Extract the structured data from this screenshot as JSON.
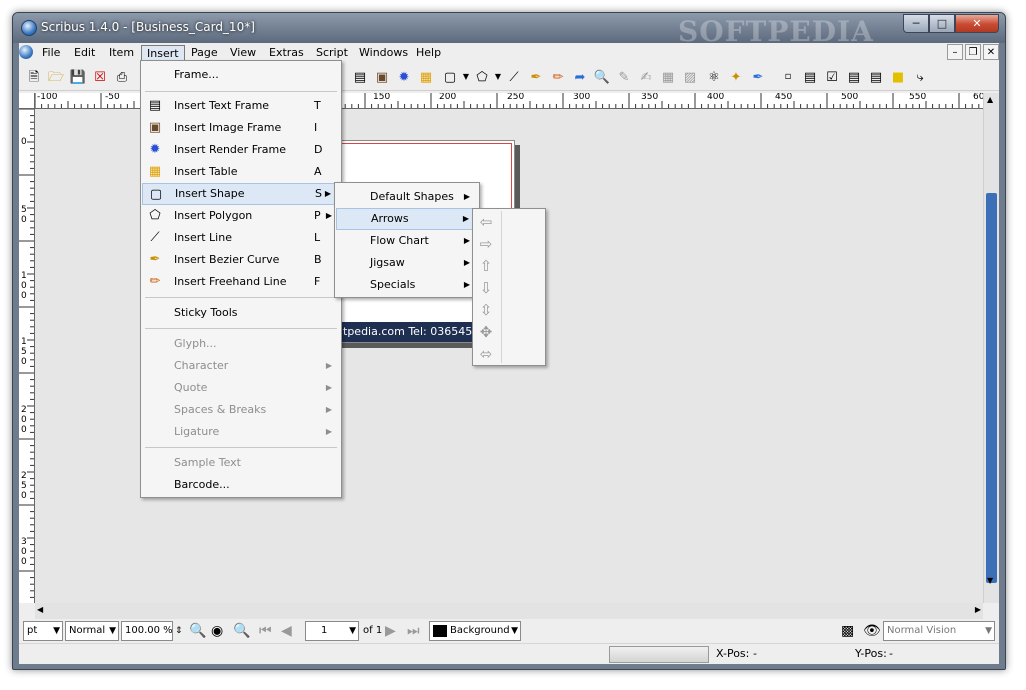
{
  "window": {
    "title": "Scribus 1.4.0 - [Business_Card_10*]",
    "watermark": "SOFTPEDIA"
  },
  "menubar": {
    "items": [
      "File",
      "Edit",
      "Item",
      "Insert",
      "Page",
      "View",
      "Extras",
      "Script",
      "Windows",
      "Help"
    ],
    "active": "Insert"
  },
  "insert_menu": {
    "frame": "Frame...",
    "text_frame": {
      "label": "Insert Text Frame",
      "shortcut": "T"
    },
    "image_frame": {
      "label": "Insert Image Frame",
      "shortcut": "I"
    },
    "render_frame": {
      "label": "Insert Render Frame",
      "shortcut": "D"
    },
    "table": {
      "label": "Insert Table",
      "shortcut": "A"
    },
    "shape": {
      "label": "Insert Shape",
      "shortcut": "S"
    },
    "polygon": {
      "label": "Insert Polygon",
      "shortcut": "P"
    },
    "line": {
      "label": "Insert Line",
      "shortcut": "L"
    },
    "bezier": {
      "label": "Insert Bezier Curve",
      "shortcut": "B"
    },
    "freehand": {
      "label": "Insert Freehand Line",
      "shortcut": "F"
    },
    "sticky": "Sticky Tools",
    "glyph": "Glyph...",
    "character": "Character",
    "quote": "Quote",
    "spaces": "Spaces & Breaks",
    "ligature": "Ligature",
    "sample_text": "Sample Text",
    "barcode": "Barcode..."
  },
  "shape_submenu": [
    "Default Shapes",
    "Arrows",
    "Flow Chart",
    "Jigsaw",
    "Specials"
  ],
  "shape_submenu_highlight": "Arrows",
  "arrows": [
    "arrow-left",
    "arrow-right",
    "arrow-up",
    "arrow-down",
    "arrow-up-down",
    "arrow-four-way",
    "arrow-left-right"
  ],
  "ruler": {
    "h_labels": [
      "-100",
      "-50",
      "150",
      "200",
      "250",
      "300",
      "350",
      "400",
      "450",
      "500",
      "550",
      "60"
    ],
    "v_labels": [
      "0",
      "5",
      "0",
      "1",
      "0",
      "0",
      "1",
      "5",
      "0",
      "2",
      "0",
      "0",
      "2",
      "5",
      "0",
      "3",
      "0",
      "0"
    ]
  },
  "page": {
    "footer_text": "tpedia.com  Tel: 0365455"
  },
  "statusbar": {
    "unit": "pt",
    "mode": "Normal",
    "zoom": "100.00 %",
    "page_num": "1",
    "page_of": "of 1",
    "layer": "Background",
    "vision": "Normal Vision"
  },
  "bottombar": {
    "xpos_label": "X-Pos:",
    "xpos_value": "-",
    "ypos_label": "Y-Pos:",
    "ypos_value": "-"
  },
  "colors": {
    "highlight": "#dce8f5",
    "page_stripe": "#1e2f52",
    "layer_swatch": "#000000"
  }
}
